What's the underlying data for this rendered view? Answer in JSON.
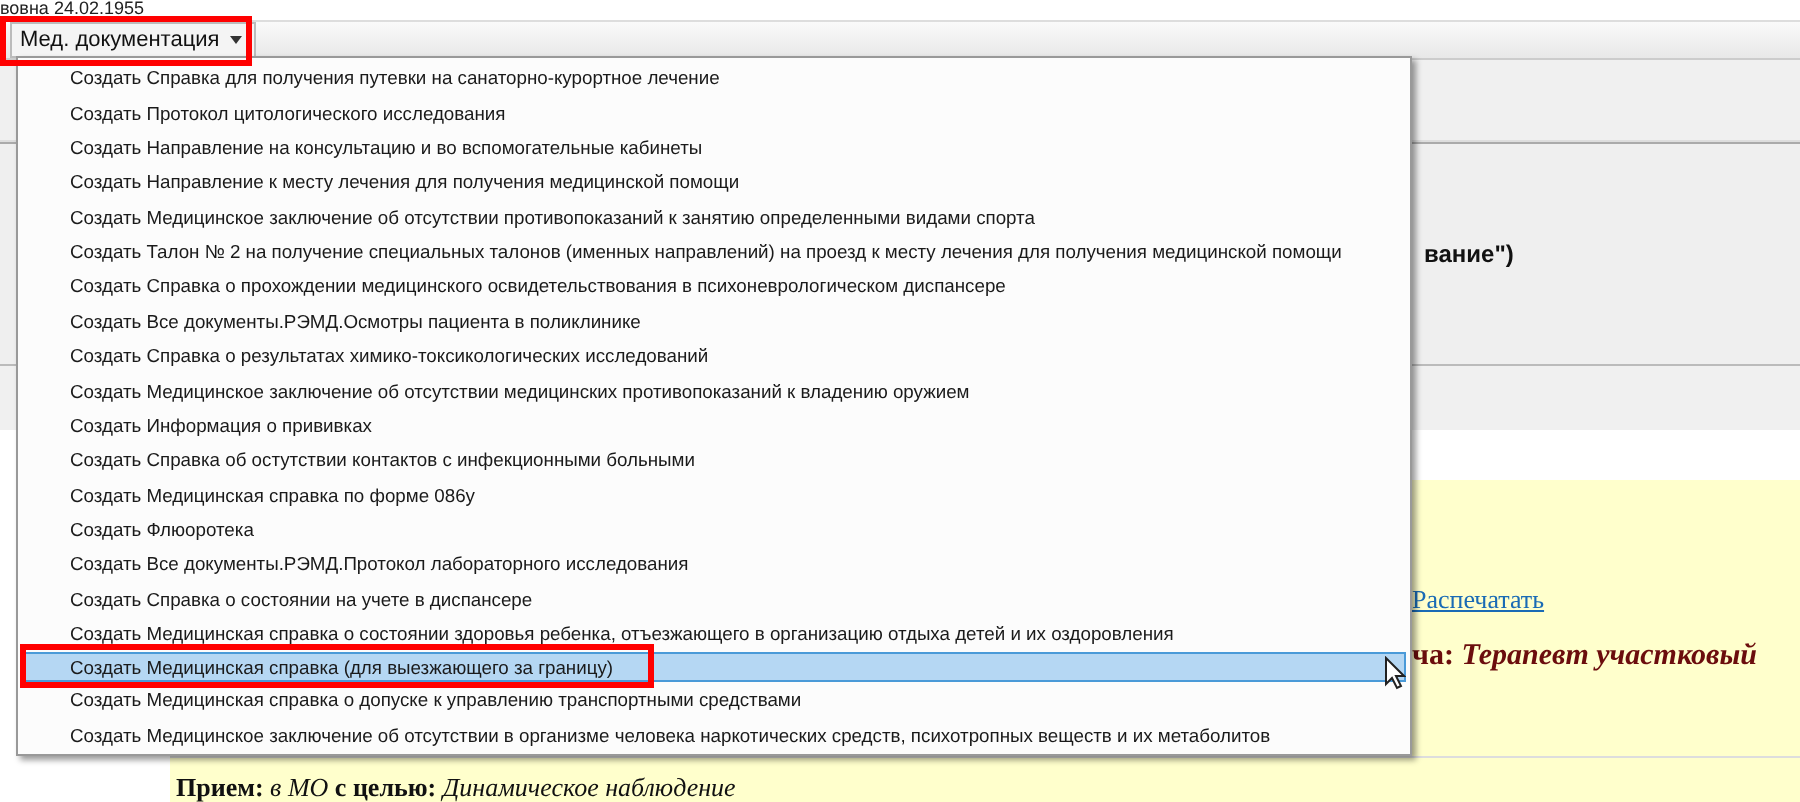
{
  "patient_line": "вовна 24.02.1955",
  "toolbar": {
    "menu_button": "Мед. документация"
  },
  "menu": {
    "items": [
      {
        "label": "Создать Справка для получения путевки на санаторно-курортное лечение",
        "selected": false
      },
      {
        "label": "Создать Протокол цитологического исследования",
        "selected": false
      },
      {
        "label": "Создать Направление на консультацию и во вспомогательные кабинеты",
        "selected": false
      },
      {
        "label": "Создать Направление к месту лечения для получения медицинской помощи",
        "selected": false
      },
      {
        "label": "Создать Медицинское заключение об отсутствии противопоказаний к занятию определенными видами спорта",
        "selected": false
      },
      {
        "label": "Создать Талон № 2 на получение специальных талонов (именных направлений) на проезд к месту лечения для получения медицинской помощи",
        "selected": false
      },
      {
        "label": "Создать Справка о прохождении медицинского освидетельствования в психоневрологическом диспансере",
        "selected": false
      },
      {
        "label": "Создать Все документы.РЭМД.Осмотры пациента в поликлинике",
        "selected": false
      },
      {
        "label": "Создать Справка о результатах химико-токсикологических исследований",
        "selected": false
      },
      {
        "label": "Создать Медицинское заключение об отсутствии медицинских противопоказаний к владению оружием",
        "selected": false
      },
      {
        "label": "Создать Информация о прививках",
        "selected": false
      },
      {
        "label": "Создать Справка об остутствии контактов с инфекционными больными",
        "selected": false
      },
      {
        "label": "Создать Медицинская справка по форме 086у",
        "selected": false
      },
      {
        "label": "Создать Флюоротека",
        "selected": false
      },
      {
        "label": "Создать Все документы.РЭМД.Протокол лабораторного исследования",
        "selected": false
      },
      {
        "label": "Создать Справка о состоянии на учете в диспансере",
        "selected": false
      },
      {
        "label": "Создать Медицинская справка о состоянии здоровья ребенка, отъезжающего в организацию отдыха детей и их оздоровления",
        "selected": false
      },
      {
        "label": "Создать Медицинская справка (для выезжающего за границу)",
        "selected": true
      },
      {
        "label": "Создать Медицинская справка о допуске к управлению транспортными средствами",
        "selected": false
      },
      {
        "label": "Создать Медицинское заключение об отсутствии в организме человека наркотических средств, психотропных веществ и их метаболитов",
        "selected": false
      }
    ]
  },
  "document": {
    "header_fragment": "вание\")",
    "print_link": "Распечатать",
    "specialty": "ча: *Терапевт участковый*",
    "visit": "**Прием:** *в МО* **с целью:** *Динамическое наблюдение*"
  }
}
